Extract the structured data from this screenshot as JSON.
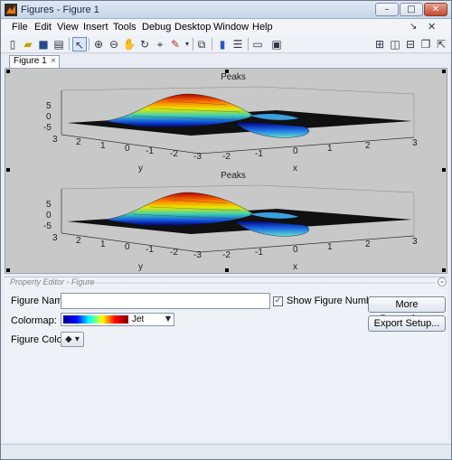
{
  "window": {
    "title": "Figures - Figure 1",
    "controls": {
      "minimize": "–",
      "maximize": "□",
      "close": "✕"
    }
  },
  "menubar": {
    "items": [
      "File",
      "Edit",
      "View",
      "Insert",
      "Tools",
      "Debug",
      "Desktop",
      "Window",
      "Help"
    ],
    "pin_left": "↘",
    "pin_right": "✕"
  },
  "toolbar": {
    "icons": [
      "new-figure-icon",
      "open-icon",
      "save-icon",
      "print-icon",
      "select-arrow-icon",
      "zoom-in-icon",
      "zoom-out-icon",
      "pan-icon",
      "rotate-3d-icon",
      "data-cursor-icon",
      "brush-icon",
      "link-icon",
      "colorbar-icon",
      "legend-icon",
      "plot-tools-icon",
      "tile-icon",
      "left-right-icon",
      "top-bottom-icon",
      "float-icon",
      "undock-icon"
    ]
  },
  "tab": {
    "label": "Figure 1",
    "close": "×"
  },
  "figure": {
    "background": "#c8c8c8",
    "plots": [
      {
        "title": "Peaks",
        "xlabel": "x",
        "ylabel": "y"
      },
      {
        "title": "Peaks",
        "xlabel": "x",
        "ylabel": "y"
      }
    ],
    "z_ticks": [
      "5",
      "0",
      "-5"
    ],
    "y_ticks": [
      "3",
      "2",
      "1",
      "0",
      "-1",
      "-2",
      "-3"
    ],
    "x_ticks": [
      "-3",
      "-2",
      "-1",
      "0",
      "1",
      "2",
      "3"
    ]
  },
  "property_editor": {
    "header": "Property Editor - Figure",
    "collapse": "⌄",
    "figure_name_label": "Figure Name:",
    "figure_name_value": "",
    "show_number_label": "Show Figure Number",
    "show_number_checked": "✓",
    "more_properties": "More Properties...",
    "export_setup": "Export Setup...",
    "colormap_label": "Colormap:",
    "colormap_value": "Jet",
    "colormap_arrow": "▼",
    "figure_color_label": "Figure Color:",
    "figure_color_button": "◆ ▾"
  }
}
